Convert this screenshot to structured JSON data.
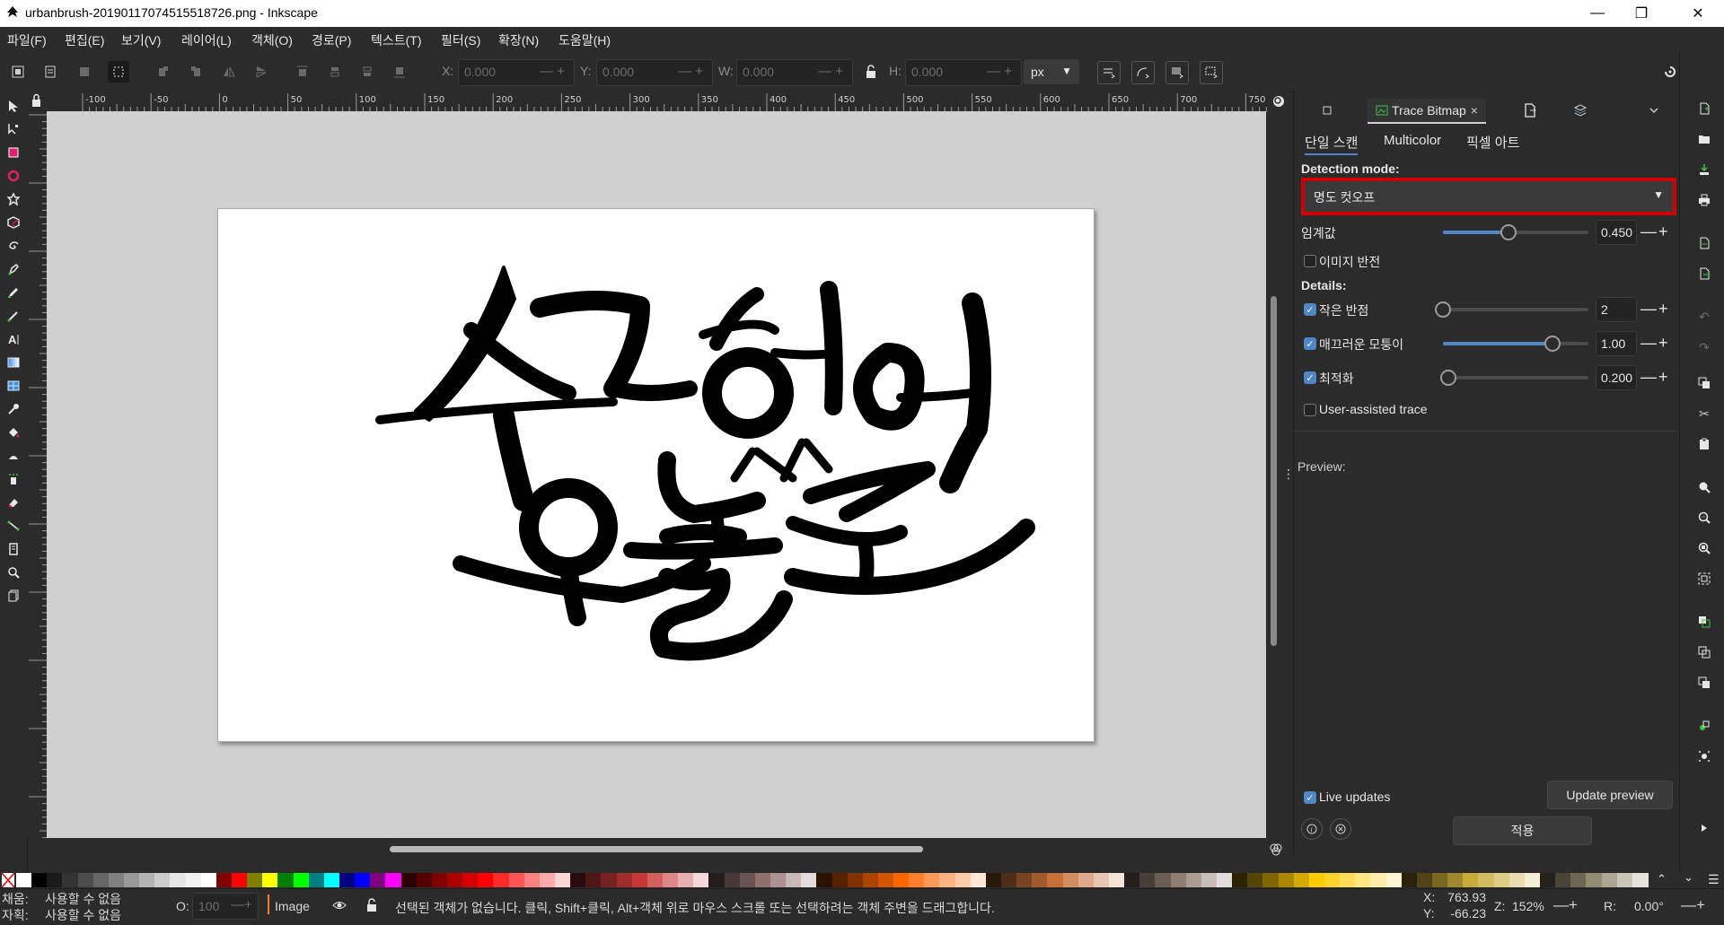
{
  "window": {
    "title": "urbanbrush-20190117074515518726.png - Inkscape",
    "controls": [
      "—",
      "❐",
      "✕"
    ]
  },
  "menu": [
    "파일(F)",
    "편집(E)",
    "보기(V)",
    "레이어(L)",
    "객체(O)",
    "경로(P)",
    "텍스트(T)",
    "필터(S)",
    "확장(N)",
    "도움말(H)"
  ],
  "toolbar": {
    "x_label": "X:",
    "x_value": "0.000",
    "y_label": "Y:",
    "y_value": "0.000",
    "w_label": "W:",
    "w_value": "0.000",
    "h_label": "H:",
    "h_value": "0.000",
    "unit": "px"
  },
  "ruler": {
    "h_ticks": [
      "-100",
      "-50",
      "0",
      "50",
      "100",
      "150",
      "200",
      "250",
      "300",
      "350",
      "400",
      "450",
      "500",
      "550",
      "600",
      "650",
      "700",
      "750"
    ]
  },
  "canvas": {
    "artwork_text_line1": "수고했어",
    "artwork_text_line2": "오늘도"
  },
  "panel": {
    "tab_label": "Trace Bitmap",
    "tab_close": "×",
    "subtabs": [
      "단일 스캔",
      "Multicolor",
      "픽셀 아트"
    ],
    "detection_mode_label": "Detection mode:",
    "detection_mode_value": "명도 컷오프",
    "threshold_label": "임계값",
    "threshold_value": "0.450",
    "threshold_fraction": 0.45,
    "invert_label": "이미지 반전",
    "invert_checked": false,
    "details_label": "Details:",
    "speckles_label": "작은 반점",
    "speckles_value": "2",
    "speckles_checked": true,
    "speckles_fraction": 0.0,
    "smooth_label": "매끄러운 모퉁이",
    "smooth_value": "1.00",
    "smooth_checked": true,
    "smooth_fraction": 0.75,
    "optimize_label": "최적화",
    "optimize_value": "0.200",
    "optimize_checked": true,
    "optimize_fraction": 0.04,
    "user_assisted_label": "User-assisted trace",
    "user_assisted_checked": false,
    "preview_label": "Preview:",
    "live_updates_label": "Live updates",
    "live_updates_checked": true,
    "update_preview_label": "Update preview",
    "apply_label": "적용",
    "spin_pm": "—+"
  },
  "status": {
    "fill_label": "채움:",
    "fill_value": "사용할 수 없음",
    "stroke_label": "자획:",
    "stroke_value": "사용할 수 없음",
    "opacity_label": "O:",
    "opacity_value": "100",
    "layer_name": "Image",
    "message": "선택된 객체가 없습니다. 클릭, Shift+클릭, Alt+객체 위로 마우스 스크롤 또는 선택하려는 객체 주변을 드래그합니다.",
    "cursor_x_label": "X:",
    "cursor_x": "763.93",
    "cursor_y_label": "Y:",
    "cursor_y": "-66.23",
    "zoom_label": "Z:",
    "zoom": "152%",
    "rotate_label": "R:",
    "rotation": "0.00°"
  },
  "palette_colors": [
    "#ffffff",
    "#000000",
    "#1a1a1a",
    "#333333",
    "#4d4d4d",
    "#666666",
    "#808080",
    "#999999",
    "#b3b3b3",
    "#cccccc",
    "#e6e6e6",
    "#f2f2f2",
    "#ffffff",
    "#800000",
    "#ff0000",
    "#808000",
    "#ffff00",
    "#008000",
    "#00ff00",
    "#008080",
    "#00ffff",
    "#000080",
    "#0000ff",
    "#800080",
    "#ff00ff",
    "#2b0000",
    "#550000",
    "#800000",
    "#aa0000",
    "#d40000",
    "#ff0000",
    "#ff2a2a",
    "#ff5555",
    "#ff8080",
    "#ffaaaa",
    "#ffd5d5",
    "#280b0b",
    "#501616",
    "#782121",
    "#a02c2c",
    "#c83737",
    "#d35f5f",
    "#de8787",
    "#e9afaf",
    "#f4d7d7",
    "#241c1c",
    "#483737",
    "#6c5353",
    "#916f6f",
    "#ac9393",
    "#c8b7b7",
    "#e3dbdb",
    "#2b1100",
    "#552200",
    "#803300",
    "#aa4400",
    "#d45500",
    "#ff6600",
    "#ff7f2a",
    "#ff9955",
    "#ffb380",
    "#ffccaa",
    "#ffe6d5",
    "#28170b",
    "#502d16",
    "#784421",
    "#a05a2c",
    "#c87137",
    "#d38d5f",
    "#deaa87",
    "#e9c6af",
    "#f4e3d7",
    "#241f1c",
    "#483e37",
    "#6c5d53",
    "#917c6f",
    "#ac9d93",
    "#c8beb7",
    "#e3dedb",
    "#2b2200",
    "#554400",
    "#806600",
    "#aa8800",
    "#d4aa00",
    "#ffcc00",
    "#ffd42a",
    "#ffdd55",
    "#ffe680",
    "#ffeeaa",
    "#fff6d5",
    "#28220b",
    "#504416",
    "#786721",
    "#a0892c",
    "#c8ab37",
    "#d3bc5f",
    "#decd87",
    "#e9ddaf",
    "#f4eed7",
    "#24221c",
    "#484537",
    "#6c6753",
    "#918a6f",
    "#aca793",
    "#c8c4b7",
    "#e3e2db"
  ],
  "colors": {
    "accent": "#4f86c6",
    "highlight_box": "#d00000",
    "canvas_bg": "#d0d0d0",
    "ui_bg": "#2b2b2b"
  }
}
